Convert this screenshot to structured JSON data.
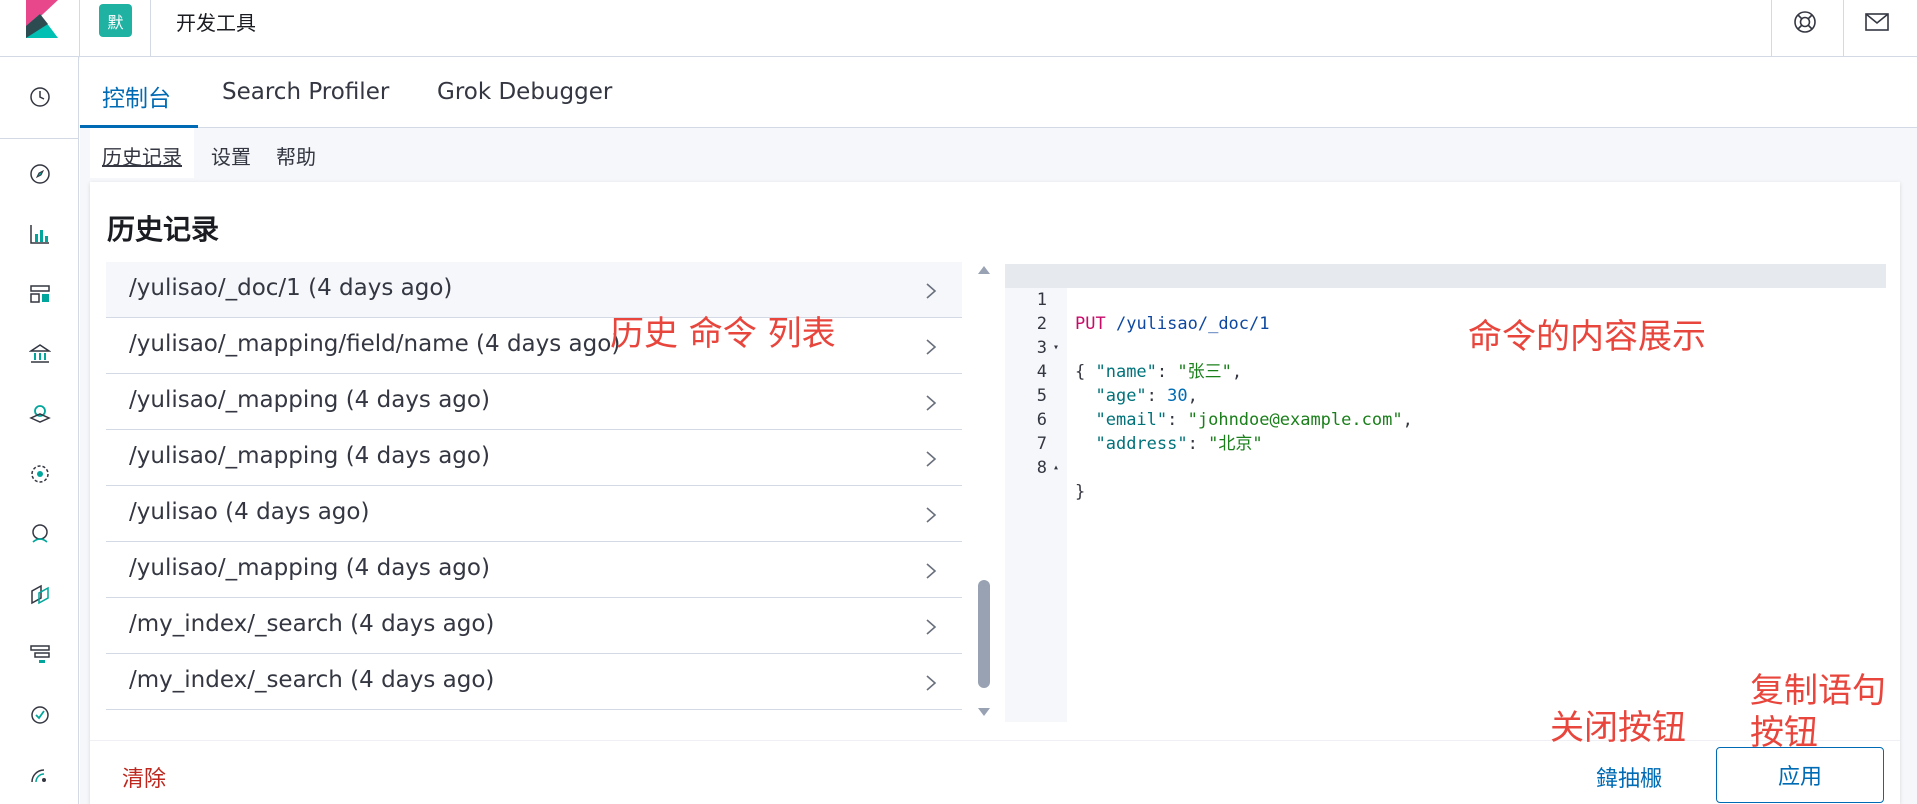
{
  "header": {
    "space_badge": "默",
    "app_title": "开发工具"
  },
  "tabs": [
    {
      "label": "控制台",
      "active": true
    },
    {
      "label": "Search Profiler",
      "active": false
    },
    {
      "label": "Grok Debugger",
      "active": false
    }
  ],
  "subnav": [
    {
      "label": "历史记录",
      "active": true
    },
    {
      "label": "设置",
      "active": false
    },
    {
      "label": "帮助",
      "active": false
    }
  ],
  "panel": {
    "title": "历史记录",
    "history": [
      {
        "text": "/yulisao/_doc/1 (4 days ago)",
        "selected": true
      },
      {
        "text": "/yulisao/_mapping/field/name (4 days ago)",
        "selected": false
      },
      {
        "text": "/yulisao/_mapping (4 days ago)",
        "selected": false
      },
      {
        "text": "/yulisao/_mapping (4 days ago)",
        "selected": false
      },
      {
        "text": "/yulisao (4 days ago)",
        "selected": false
      },
      {
        "text": "/yulisao/_mapping (4 days ago)",
        "selected": false
      },
      {
        "text": "/my_index/_search (4 days ago)",
        "selected": false
      },
      {
        "text": "/my_index/_search (4 days ago)",
        "selected": false
      }
    ],
    "code": {
      "line_numbers": [
        "1",
        "2",
        "3",
        "4",
        "5",
        "6",
        "7",
        "8"
      ],
      "method": "PUT",
      "path": "/yulisao/_doc/1",
      "open_brace": "{",
      "close_brace": "}",
      "fields": [
        {
          "key": "\"name\"",
          "value": "\"张三\"",
          "kind": "string",
          "comma": ","
        },
        {
          "key": "\"age\"",
          "value": "30",
          "kind": "number",
          "comma": ","
        },
        {
          "key": "\"email\"",
          "value": "\"johndoe@example.com\"",
          "kind": "string",
          "comma": ","
        },
        {
          "key": "\"address\"",
          "value": "\"北京\"",
          "kind": "string",
          "comma": ""
        }
      ]
    },
    "footer": {
      "clear_label": "清除",
      "close_label": "鍏抽棴",
      "apply_label": "应用"
    }
  },
  "annotations": {
    "history_list": "历史 命令 列表",
    "command_content": "命令的内容展示",
    "close_button": "关闭按钮",
    "copy_button": "复制语句\n按钮"
  },
  "colors": {
    "accent": "#006bb4",
    "danger": "#bd271e",
    "annotation": "#e8453c",
    "badge": "#1fb2a3"
  }
}
